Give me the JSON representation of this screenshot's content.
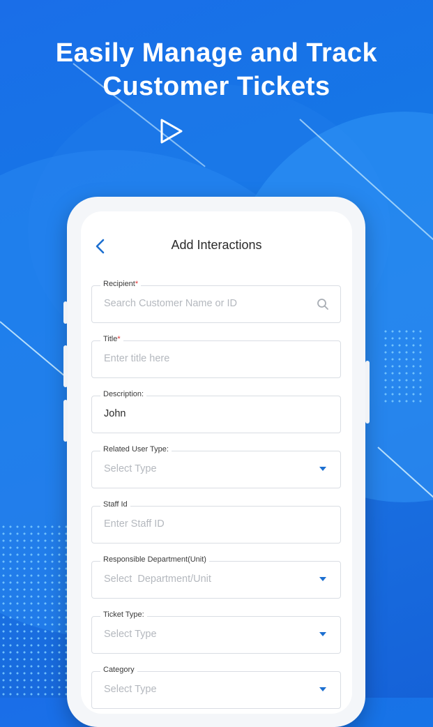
{
  "headline": {
    "line1": "Easily Manage and Track",
    "line2": "Customer Tickets"
  },
  "screen": {
    "title": "Add Interactions",
    "back_icon": "chevron-left-icon"
  },
  "form": {
    "recipient": {
      "label": "Recipient",
      "required_mark": "*",
      "placeholder": "Search Customer Name or ID",
      "icon": "search-icon"
    },
    "title": {
      "label": "Title",
      "required_mark": "*",
      "placeholder": "Enter title here"
    },
    "description": {
      "label": "Description:",
      "value": "John"
    },
    "related_user_type": {
      "label": "Related User Type:",
      "selected": "Select Type"
    },
    "staff_id": {
      "label": "Staff Id",
      "placeholder": "Enter Staff ID"
    },
    "responsible_department": {
      "label": "Responsible Department(Unit)",
      "selected": "Select  Department/Unit"
    },
    "ticket_type": {
      "label": "Ticket Type:",
      "selected": "Select Type"
    },
    "category": {
      "label": "Category",
      "selected": "Select Type"
    }
  },
  "colors": {
    "accent": "#1c6fd0",
    "background": "#1a6ee8",
    "required": "#e03131"
  }
}
